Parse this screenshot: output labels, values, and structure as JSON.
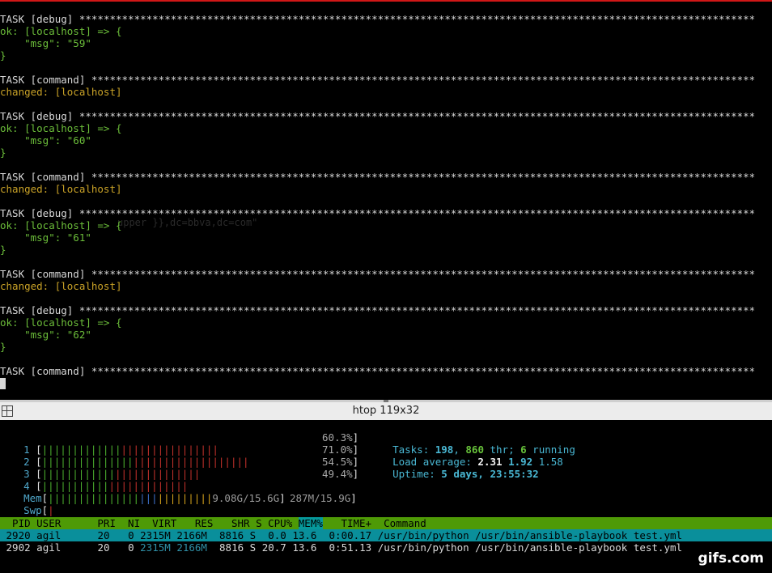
{
  "ansible_output": {
    "task_debug": "TASK [debug] ",
    "task_command": "TASK [command] ",
    "ok_line": "ok: [localhost] => {",
    "changed_line": "changed: [localhost]",
    "close_brace": "}",
    "msgs": [
      "    \"msg\": \"59\"",
      "    \"msg\": \"60\"",
      "    \"msg\": \"61\"",
      "    \"msg\": \"62\""
    ]
  },
  "background_ghost": {
    "line1": "upper }},dc=bbva,dc=com\""
  },
  "pane": {
    "title": "htop 119x32"
  },
  "htop": {
    "cpus": [
      {
        "label": "1",
        "percent": "60.3%",
        "green": 0.45,
        "red": 0.55
      },
      {
        "label": "2",
        "percent": "71.0%",
        "green": 0.45,
        "red": 0.55
      },
      {
        "label": "3",
        "percent": "54.5%",
        "green": 0.45,
        "red": 0.55
      },
      {
        "label": "4",
        "percent": "49.4%",
        "green": 0.45,
        "red": 0.55
      }
    ],
    "mem": {
      "label": "Mem",
      "value": "9.08G/15.6G"
    },
    "swp": {
      "label": "Swp",
      "value": "287M/15.9G"
    },
    "tasks_label": "Tasks: ",
    "tasks_count": "198",
    "tasks_sep": ", ",
    "threads_count": "860",
    "threads_label": " thr; ",
    "running_count": "6",
    "running_label": " running",
    "load_label": "Load average: ",
    "load_1": "2.31",
    "load_5": "1.92",
    "load_15": "1.58",
    "uptime_label": "Uptime: ",
    "uptime_value": "5 days, 23:55:32",
    "columns": {
      "pre": "  PID USER      PRI  NI  VIRT   RES   SHR S CPU% ",
      "mem": "MEM%",
      "post": "   TIME+  Command"
    },
    "processes": [
      {
        "pid": " 2920",
        "user": "agil",
        "pri": "20",
        "ni": "0",
        "virt": "2315M",
        "res": "2166M",
        "shr": "8816",
        "s": "S",
        "cpu": "0.0",
        "mem": "13.6",
        "time": "0:00.17",
        "command": "/usr/bin/python /usr/bin/ansible-playbook test.yml"
      },
      {
        "pid": " 2902",
        "user": "agil",
        "pri": "20",
        "ni": "0",
        "virt": "2315M",
        "res": "2166M",
        "shr": "8816",
        "s": "S",
        "cpu": "20.7",
        "mem": "13.6",
        "time": "0:51.13",
        "command": "/usr/bin/python /usr/bin/ansible-playbook test.yml"
      }
    ]
  },
  "watermark": "gifs.com",
  "colors": {
    "ok_green": "#6cbe3a",
    "changed_yellow": "#c9a227",
    "header_green": "#4e9a06",
    "selected_cyan": "#0a8f9b"
  }
}
